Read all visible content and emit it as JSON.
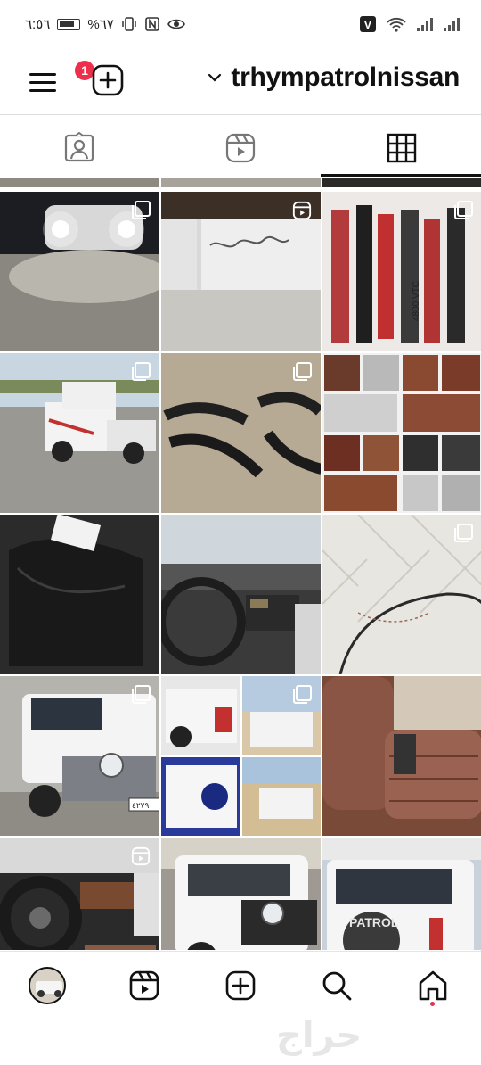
{
  "status_bar": {
    "time": "٦:٥٦",
    "battery_percent": "%٦٧",
    "icons": [
      "battery-icon",
      "vibrate-icon",
      "nfc-icon",
      "eye-icon",
      "volte-icon",
      "wifi-icon",
      "signal-icon",
      "signal-icon"
    ]
  },
  "header": {
    "notification_count": "1",
    "username": "trhympatrolnissan"
  },
  "tabs": [
    {
      "name": "tagged",
      "icon": "tagged-person-icon"
    },
    {
      "name": "reels",
      "icon": "reels-icon"
    },
    {
      "name": "grid",
      "icon": "grid-icon",
      "active": true
    }
  ],
  "grid": {
    "posts": [
      {
        "subject": "car headlights at night",
        "indicator": "multi"
      },
      {
        "subject": "graffiti wall",
        "indicator": "reel"
      },
      {
        "subject": "patrol decal stickers",
        "indicator": "multi"
      },
      {
        "subject": "white nissan pickup",
        "indicator": "multi"
      },
      {
        "subject": "black fender flares",
        "indicator": "multi"
      },
      {
        "subject": "wood trim panels collage",
        "indicator": "none"
      },
      {
        "subject": "black car covers",
        "indicator": "none"
      },
      {
        "subject": "dashboard interior",
        "indicator": "none"
      },
      {
        "subject": "white leather seat",
        "indicator": "multi"
      },
      {
        "subject": "white nissan patrol suv",
        "indicator": "multi"
      },
      {
        "subject": "patrol collage",
        "indicator": "multi"
      },
      {
        "subject": "brown leather seats",
        "indicator": "none"
      },
      {
        "subject": "steering wheel interior",
        "indicator": "reel"
      },
      {
        "subject": "white patrol front",
        "indicator": "none"
      },
      {
        "subject": "white patrol rear with spare tire",
        "indicator": "none"
      }
    ],
    "spare_tire_text": "PATROL",
    "decal_text": "4800 VTC",
    "plate_text": "٤٢٧٩"
  },
  "bottom_nav": {
    "items": [
      "profile-avatar",
      "reels-icon",
      "create-icon",
      "search-icon",
      "home-icon"
    ]
  },
  "watermark": "حراج"
}
